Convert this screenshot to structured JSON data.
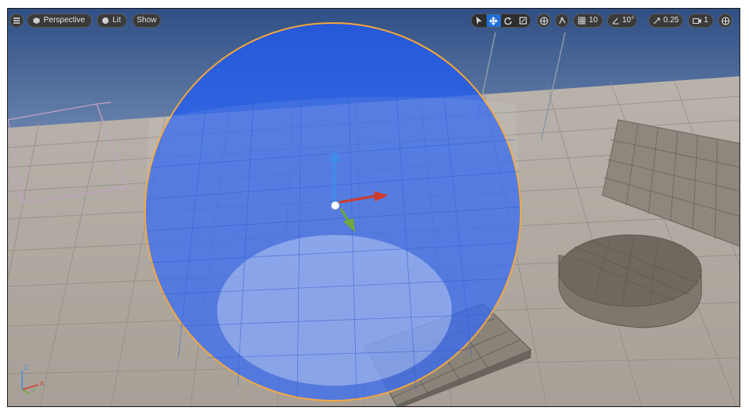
{
  "toolbar": {
    "menu_icon": "hamburger-icon",
    "perspective_label": "Perspective",
    "lit_label": "Lit",
    "show_label": "Show",
    "transform_tools": [
      "select-icon",
      "translate-icon",
      "rotate-icon",
      "scale-icon"
    ],
    "active_tool": "translate-icon",
    "grid_snap_value": "10",
    "rotation_snap_value": "10°",
    "scale_snap_value": "0.25",
    "camera_speed_value": "1"
  },
  "axis_indicator": {
    "x_label": "X",
    "y_label": "Y",
    "z_label": "Z"
  },
  "colors": {
    "sky": "#3d5f95",
    "floor": "#b3aba2",
    "sphere_fill": "#1e5af5",
    "sphere_outline": "#f3a53b",
    "gizmo_x": "#d03a2a",
    "gizmo_y": "#6ea63c",
    "gizmo_z": "#3c8ee8",
    "active_tool": "#1f6fd6"
  }
}
